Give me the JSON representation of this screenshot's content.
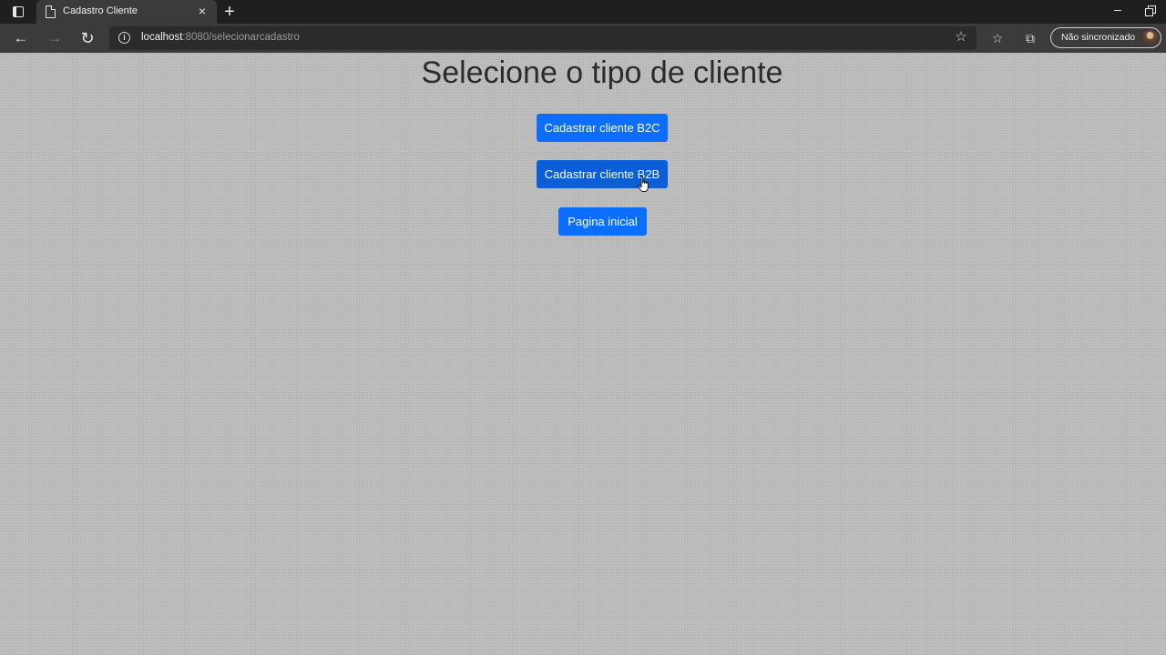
{
  "browser": {
    "tab_title": "Cadastro Cliente",
    "tab_close": "×",
    "new_tab": "+",
    "minimize": "–",
    "url_host": "localhost",
    "url_rest": ":8080/selecionarcadastro",
    "profile_label": "Não sincronizado",
    "nav_back": "←",
    "nav_forward": "→",
    "nav_refresh": "↻",
    "fav_star": "☆",
    "favorites_icon": "☆",
    "collections_icon": "⧉",
    "info_icon": "i"
  },
  "page": {
    "title": "Selecione o tipo de cliente",
    "buttons": {
      "b2c": "Cadastrar cliente B2C",
      "b2b": "Cadastrar cliente B2B",
      "home": "Pagina inicial"
    }
  },
  "colors": {
    "button_primary": "#0d6efd",
    "button_hover": "#0b5ed7",
    "page_background": "#bdbdbd",
    "title_text": "#2b2b2b"
  }
}
